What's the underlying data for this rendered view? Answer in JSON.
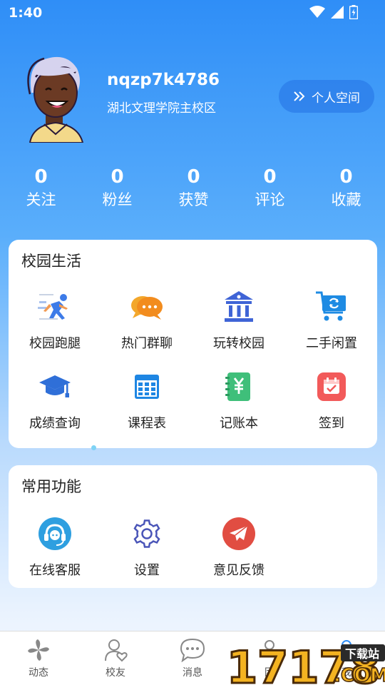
{
  "status_bar": {
    "time": "1:40"
  },
  "profile": {
    "username": "nqzp7k4786",
    "campus": "湖北文理学院主校区",
    "space_button": "个人空间"
  },
  "stats": [
    {
      "value": "0",
      "label": "关注"
    },
    {
      "value": "0",
      "label": "粉丝"
    },
    {
      "value": "0",
      "label": "获赞"
    },
    {
      "value": "0",
      "label": "评论"
    },
    {
      "value": "0",
      "label": "收藏"
    }
  ],
  "campus_life": {
    "title": "校园生活",
    "items": [
      {
        "label": "校园跑腿",
        "icon": "running-man-icon"
      },
      {
        "label": "热门群聊",
        "icon": "chat-bubbles-icon"
      },
      {
        "label": "玩转校园",
        "icon": "campus-building-icon"
      },
      {
        "label": "二手闲置",
        "icon": "shopping-cart-icon"
      },
      {
        "label": "成绩查询",
        "icon": "graduation-cap-icon"
      },
      {
        "label": "课程表",
        "icon": "calendar-grid-icon"
      },
      {
        "label": "记账本",
        "icon": "yuan-notebook-icon"
      },
      {
        "label": "签到",
        "icon": "checkin-calendar-icon"
      }
    ]
  },
  "common_functions": {
    "title": "常用功能",
    "items": [
      {
        "label": "在线客服",
        "icon": "headset-support-icon"
      },
      {
        "label": "设置",
        "icon": "gear-icon"
      },
      {
        "label": "意见反馈",
        "icon": "paper-plane-icon"
      }
    ]
  },
  "tabbar": [
    {
      "label": "动态",
      "icon": "pinwheel-icon"
    },
    {
      "label": "校友",
      "icon": "user-heart-icon"
    },
    {
      "label": "消息",
      "icon": "message-bubble-icon"
    },
    {
      "label": "团",
      "icon": "group-icon"
    },
    {
      "label": "我",
      "icon": "profile-icon"
    }
  ],
  "watermark": {
    "brand": "17178",
    "suffix": ".COM",
    "badge": "下载站"
  },
  "colors": {
    "primary": "#2f8ef7",
    "card": "#ffffff"
  }
}
